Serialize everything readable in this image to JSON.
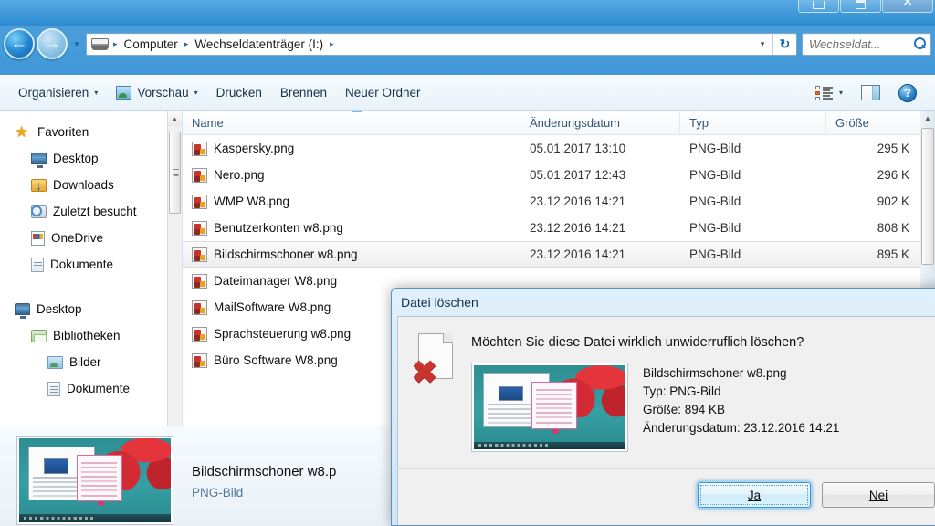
{
  "window": {
    "controls": {
      "minimize": "minimize-button",
      "maximize": "maximize-button",
      "close": "close-button"
    }
  },
  "address": {
    "back_label": "←",
    "forward_label": "→",
    "history_caret": "▾",
    "crumbs": [
      "Computer",
      "Wechseldatenträger (I:)"
    ],
    "separator": "▸",
    "dropdown_caret": "▾",
    "refresh_label": "↻"
  },
  "search": {
    "placeholder": "Wechseldat...",
    "value": ""
  },
  "toolbar": {
    "organize": "Organisieren",
    "preview": "Vorschau",
    "print": "Drucken",
    "burn": "Brennen",
    "new_folder": "Neuer Ordner",
    "caret": "▾",
    "help": "?"
  },
  "navigation": {
    "groups": [
      {
        "header": {
          "label": "Favoriten",
          "icon": "star-icon"
        },
        "items": [
          {
            "label": "Desktop",
            "icon": "monitor-icon"
          },
          {
            "label": "Downloads",
            "icon": "downloads-folder-icon"
          },
          {
            "label": "Zuletzt besucht",
            "icon": "recent-places-icon"
          },
          {
            "label": "OneDrive",
            "icon": "onedrive-icon"
          },
          {
            "label": "Dokumente",
            "icon": "document-icon"
          }
        ]
      },
      {
        "header": {
          "label": "Desktop",
          "icon": "monitor-icon"
        },
        "items": [
          {
            "label": "Bibliotheken",
            "icon": "library-folder-icon"
          },
          {
            "label": "Bilder",
            "icon": "pictures-icon"
          },
          {
            "label": "Dokumente",
            "icon": "document-icon"
          }
        ]
      }
    ],
    "scroll_up": "▲",
    "scroll_down": "▼"
  },
  "filelist": {
    "columns": [
      "Name",
      "Änderungsdatum",
      "Typ",
      "Größe"
    ],
    "sorted_column": "Änderungsdatum",
    "rows": [
      {
        "name": "Kaspersky.png",
        "date": "05.01.2017 13:10",
        "type": "PNG-Bild",
        "size": "295 K",
        "selected": false
      },
      {
        "name": "Nero.png",
        "date": "05.01.2017 12:43",
        "type": "PNG-Bild",
        "size": "296 K",
        "selected": false
      },
      {
        "name": "WMP W8.png",
        "date": "23.12.2016 14:21",
        "type": "PNG-Bild",
        "size": "902 K",
        "selected": false
      },
      {
        "name": "Benutzerkonten w8.png",
        "date": "23.12.2016 14:21",
        "type": "PNG-Bild",
        "size": "808 K",
        "selected": false
      },
      {
        "name": "Bildschirmschoner w8.png",
        "date": "23.12.2016 14:21",
        "type": "PNG-Bild",
        "size": "895 K",
        "selected": true
      },
      {
        "name": "Dateimanager W8.png",
        "date": "",
        "type": "",
        "size": "",
        "selected": false
      },
      {
        "name": "MailSoftware W8.png",
        "date": "",
        "type": "",
        "size": "",
        "selected": false
      },
      {
        "name": "Sprachsteuerung w8.png",
        "date": "",
        "type": "",
        "size": "",
        "selected": false
      },
      {
        "name": "Büro Software W8.png",
        "date": "",
        "type": "",
        "size": "",
        "selected": false
      }
    ],
    "scroll_left": "◀",
    "scroll_right": "▶",
    "scroll_up": "▲",
    "scroll_down": "▼"
  },
  "details": {
    "filename": "Bildschirmschoner w8.p",
    "filetype": "PNG-Bild"
  },
  "dialog": {
    "title": "Datei löschen",
    "question": "Möchten Sie diese Datei wirklich unwiderruflich löschen?",
    "icon": "delete-file-icon",
    "file": {
      "name": "Bildschirmschoner w8.png",
      "type": "Typ: PNG-Bild",
      "size": "Größe: 894 KB",
      "modified": "Änderungsdatum: 23.12.2016 14:21"
    },
    "buttons": {
      "yes": "Ja",
      "no": "Nei"
    }
  },
  "colors": {
    "accent": "#2f8ccf",
    "title_gradient_top": "#58aae3",
    "dialog_bg": "#f0f0f0",
    "focus_glow": "#3c96d4",
    "delete_x": "#c9342c"
  }
}
